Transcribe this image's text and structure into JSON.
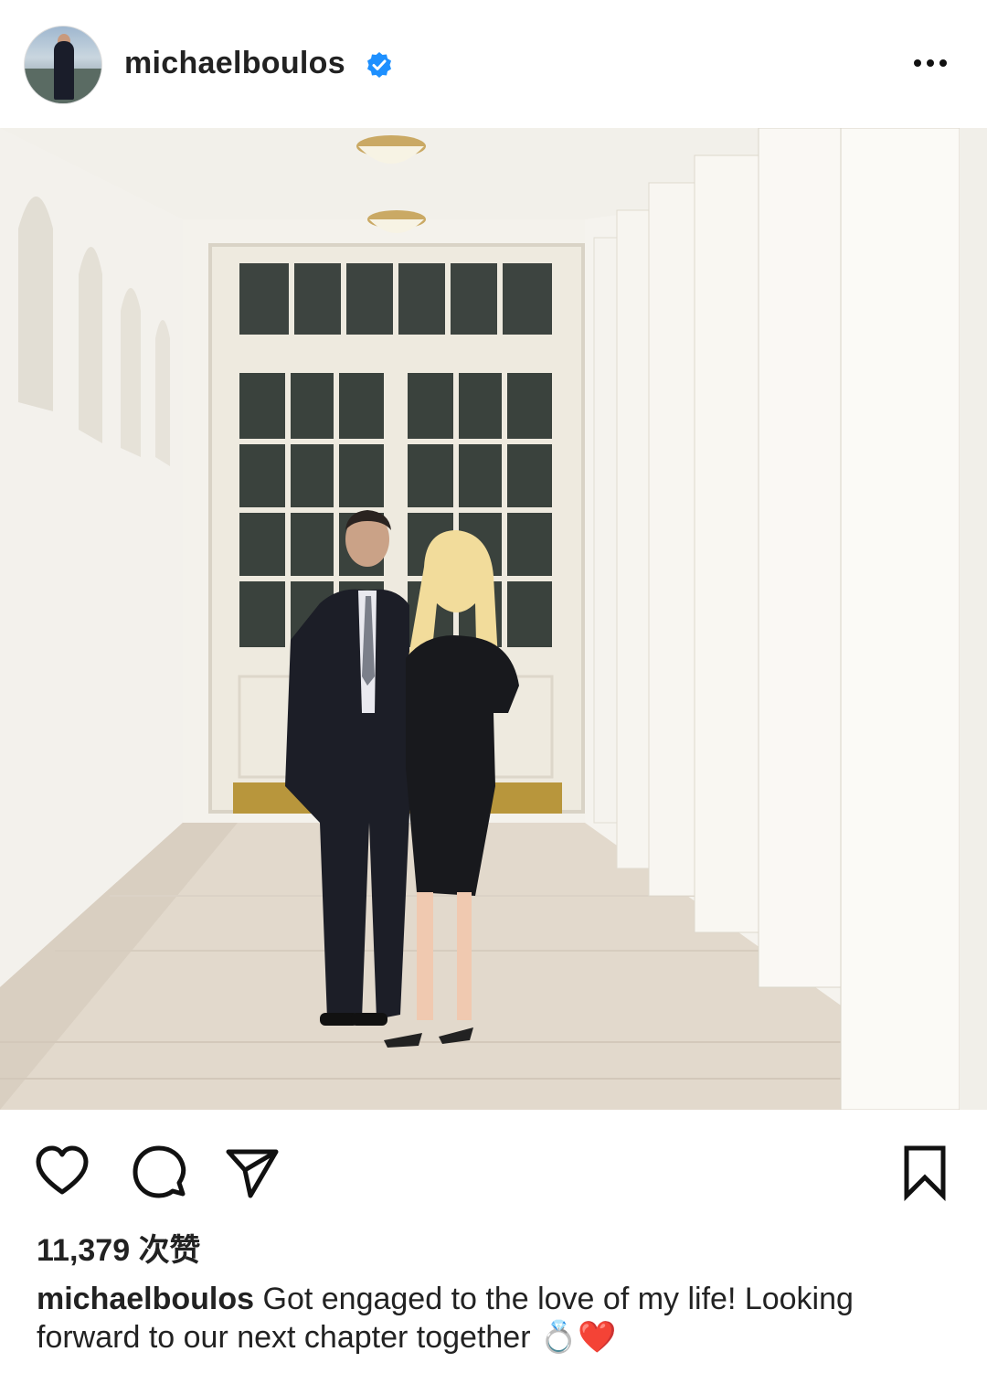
{
  "header": {
    "username": "michaelboulos",
    "avatar_icon": "profile-avatar",
    "verified_icon": "verified-badge-icon",
    "verified_color": "#1e90ff",
    "more_icon": "more-options-icon"
  },
  "post": {
    "photo_description_icon": "post-photo",
    "actions": {
      "like_icon": "heart-icon",
      "comment_icon": "comment-icon",
      "share_icon": "send-icon",
      "save_icon": "bookmark-icon"
    },
    "likes_text": "11,379 次赞",
    "caption": {
      "author": "michaelboulos",
      "text": "Got engaged to the love of my life! Looking forward to our next chapter together 💍❤️"
    }
  }
}
